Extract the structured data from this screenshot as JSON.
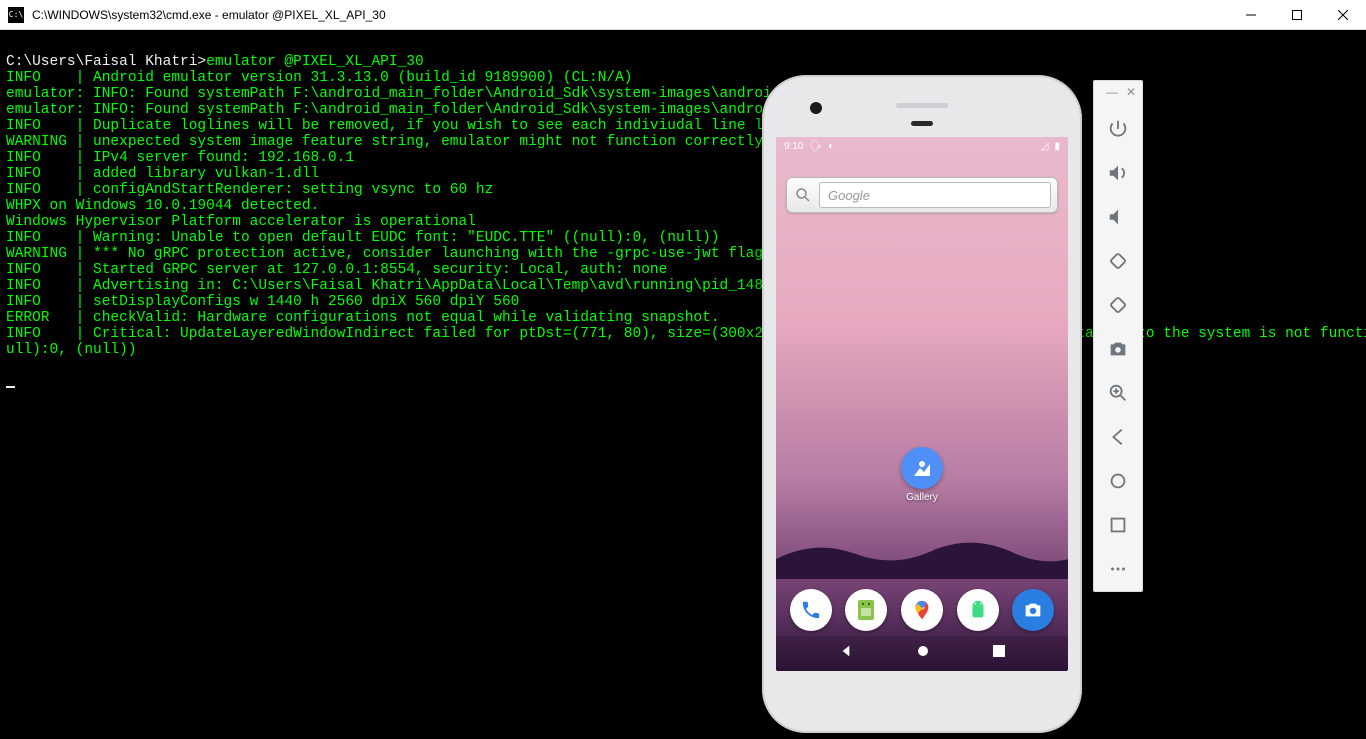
{
  "window": {
    "title": "C:\\WINDOWS\\system32\\cmd.exe - emulator  @PIXEL_XL_API_30",
    "icon_text": "C:\\"
  },
  "terminal": {
    "prompt": "C:\\Users\\Faisal Khatri>",
    "command": "emulator @PIXEL_XL_API_30",
    "lines": [
      "INFO    | Android emulator version 31.3.13.0 (build_id 9189900) (CL:N/A)",
      "emulator: INFO: Found systemPath F:\\android_main_folder\\Android_Sdk\\system-images\\android-30\\google_apis\\x86\\",
      "emulator: INFO: Found systemPath F:\\android_main_folder\\Android_Sdk\\system-images\\android-30\\google_apis\\x86\\",
      "INFO    | Duplicate loglines will be removed, if you wish to see each indiviudal line launch with the -log-nofilter flag.",
      "WARNING | unexpected system image feature string, emulator might not function correctly, please try updating the emulator.",
      "INFO    | IPv4 server found: 192.168.0.1",
      "INFO    | added library vulkan-1.dll",
      "INFO    | configAndStartRenderer: setting vsync to 60 hz",
      "WHPX on Windows 10.0.19044 detected.",
      "Windows Hypervisor Platform accelerator is operational",
      "INFO    | Warning: Unable to open default EUDC font: \"EUDC.TTE\" ((null):0, (null))",
      "",
      "WARNING | *** No gRPC protection active, consider launching with the -grpc-use-jwt flag.***",
      "INFO    | Started GRPC server at 127.0.0.1:8554, security: Local, auth: none",
      "INFO    | Advertising in: C:\\Users\\Faisal Khatri\\AppData\\Local\\Temp\\avd\\running\\pid_14888.ini",
      "INFO    | setDisplayConfigs w 1440 h 2560 dpiX 560 dpiY 560",
      "ERROR   | checkValid: Hardware configurations not equal while validating snapshot.",
      "INFO    | Critical: UpdateLayeredWindowIndirect failed for ptDst=(771, 80), size=(300x21), dirty=(300x21 0, 0) (A device attached to the system is not functioning.) ((n",
      "ull):0, (null))"
    ]
  },
  "toolbar": {
    "buttons": [
      "power",
      "volume-up",
      "volume-down",
      "rotate-left",
      "rotate-right",
      "screenshot",
      "zoom-in",
      "back",
      "home",
      "overview",
      "more"
    ]
  },
  "phone": {
    "status": {
      "time": "9:10",
      "signal": "△",
      "battery": "▮"
    },
    "search_placeholder": "Google",
    "gallery_label": "Gallery",
    "dock": [
      "phone",
      "messages",
      "maps",
      "android",
      "camera"
    ]
  }
}
